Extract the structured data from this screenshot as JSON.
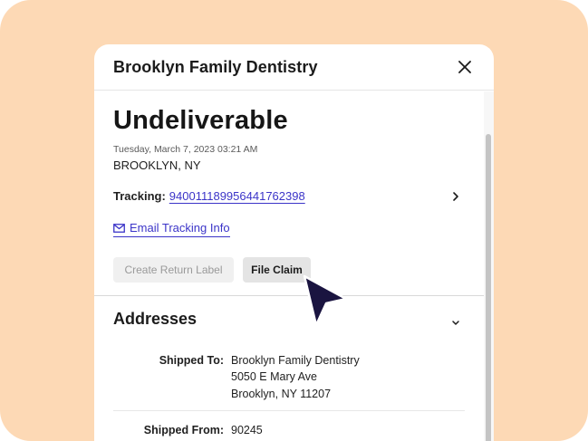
{
  "panel": {
    "title": "Brooklyn Family Dentistry"
  },
  "shipment": {
    "status": "Undeliverable",
    "timestamp": "Tuesday, March 7, 2023 03:21 AM",
    "location": "BROOKLYN, NY",
    "tracking_label": "Tracking:",
    "tracking_number": "9400111899564417623​98",
    "email_link": "Email Tracking Info"
  },
  "actions": {
    "return_label": "Create Return Label",
    "file_claim": "File Claim"
  },
  "addresses": {
    "title": "Addresses",
    "shipped_to_label": "Shipped To:",
    "shipped_to_lines": [
      "Brooklyn Family Dentistry",
      "5050 E Mary Ave",
      "Brooklyn, NY 11207"
    ],
    "shipped_from_label": "Shipped From:",
    "shipped_from_value": "90245"
  },
  "colors": {
    "background": "#fdd9b5",
    "link": "#3b34c8",
    "cursor": "#1a1440"
  },
  "icons": {
    "close": "close-icon",
    "chevron_right": "chevron-right-icon",
    "chevron_down": "chevron-down-icon",
    "mail": "mail-icon",
    "cursor": "mouse-pointer-icon"
  }
}
